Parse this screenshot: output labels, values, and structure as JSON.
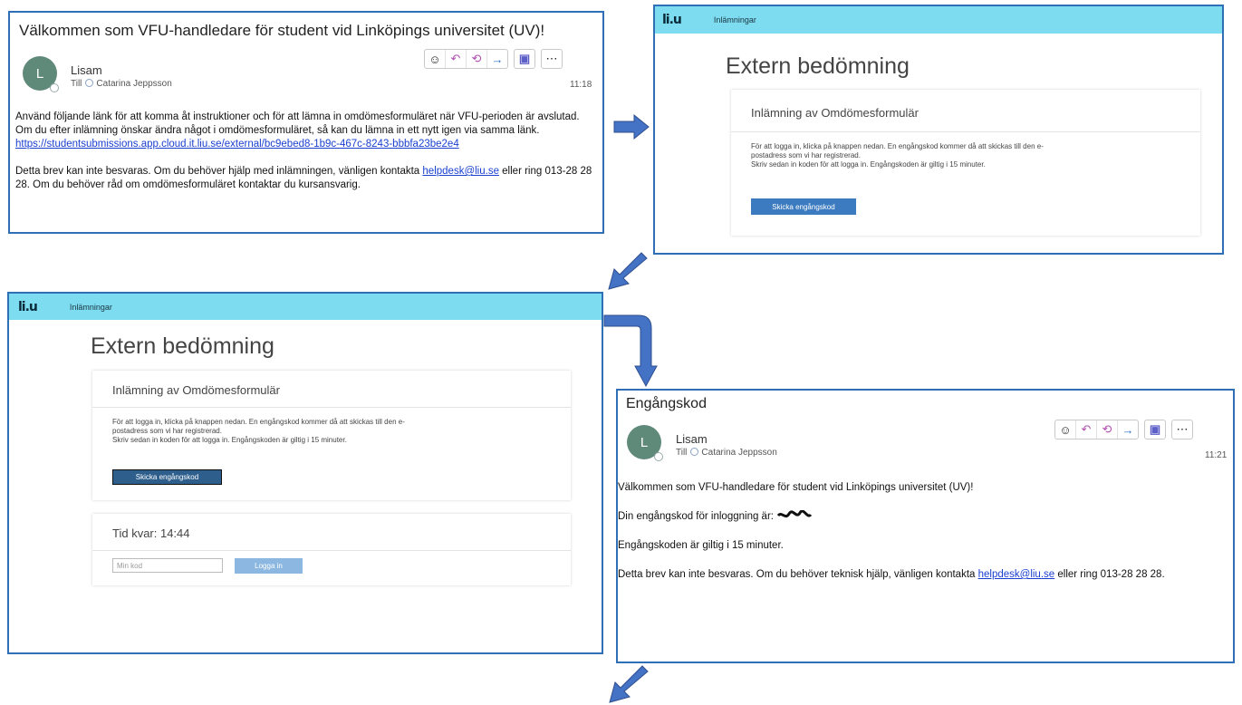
{
  "panel1": {
    "subject": "Välkommen som VFU-handledare för student vid Linköpings universitet (UV)!",
    "avatar_initial": "L",
    "sender": "Lisam",
    "to_label": "Till",
    "recipient": "Catarina Jeppsson",
    "time": "11:18",
    "body_line1": "Använd följande länk för att komma åt instruktioner och för att lämna in omdömesformuläret när VFU-perioden är avslutad. Om du efter inlämning önskar ändra något i omdömesformuläret, så kan du lämna in ett nytt igen via samma länk.",
    "link": "https://studentsubmissions.app.cloud.it.liu.se/external/bc9ebed8-1b9c-467c-8243-bbbfa23be2e4",
    "body_p2_before": "Detta brev kan inte besvaras. Om du behöver hjälp med inlämningen, vänligen kontakta ",
    "helpdesk": "helpdesk@liu.se",
    "body_p2_after": " eller ring 013-28 28 28. Om du behöver råd om omdömesformuläret kontaktar du kursansvarig."
  },
  "panel2": {
    "logo": "li.u",
    "nav": "Inlämningar",
    "title": "Extern bedömning",
    "card_title": "Inlämning av Omdömesformulär",
    "text1": "För att logga in, klicka på knappen nedan. En engångskod kommer då att skickas till den e-postadress som vi har registrerad.",
    "text2": "Skriv sedan in koden för att logga in. Engångskoden är giltig i 15 minuter.",
    "button": "Skicka engångskod"
  },
  "panel3": {
    "logo": "li.u",
    "nav": "Inlämningar",
    "title": "Extern bedömning",
    "card_title": "Inlämning av Omdömesformulär",
    "text1": "För att logga in, klicka på knappen nedan. En engångskod kommer då att skickas till den e-postadress som vi har registrerad.",
    "text2": "Skriv sedan in koden för att logga in. Engångskoden är giltig i 15 minuter.",
    "button": "Skicka engångskod",
    "timer_label": "Tid kvar: 14:44",
    "code_placeholder": "Min kod",
    "login_button": "Logga in"
  },
  "panel4": {
    "subject": "Engångskod",
    "avatar_initial": "L",
    "sender": "Lisam",
    "to_label": "Till",
    "recipient": "Catarina Jeppsson",
    "time": "11:21",
    "line1": "Välkommen som VFU-handledare för student vid Linköpings universitet (UV)!",
    "line2": "Din engångskod för inloggning är:",
    "line3": "Engångskoden är giltig i 15 minuter.",
    "line4_before": "Detta brev kan inte besvaras. Om du behöver teknisk hjälp, vänligen kontakta ",
    "helpdesk": "helpdesk@liu.se",
    "line4_after": " eller ring 013-28 28 28."
  },
  "icons": {
    "emoji": "smiley-icon",
    "reply": "reply-icon",
    "reply_all": "reply-all-icon",
    "forward": "forward-icon",
    "teams": "teams-icon",
    "more": "more-icon"
  },
  "colors": {
    "panel_border": "#2f6fb5",
    "topbar": "#7ddcf0",
    "button": "#3c7bbf",
    "arrow_fill": "#4472c4",
    "link": "#1a3fd0"
  }
}
